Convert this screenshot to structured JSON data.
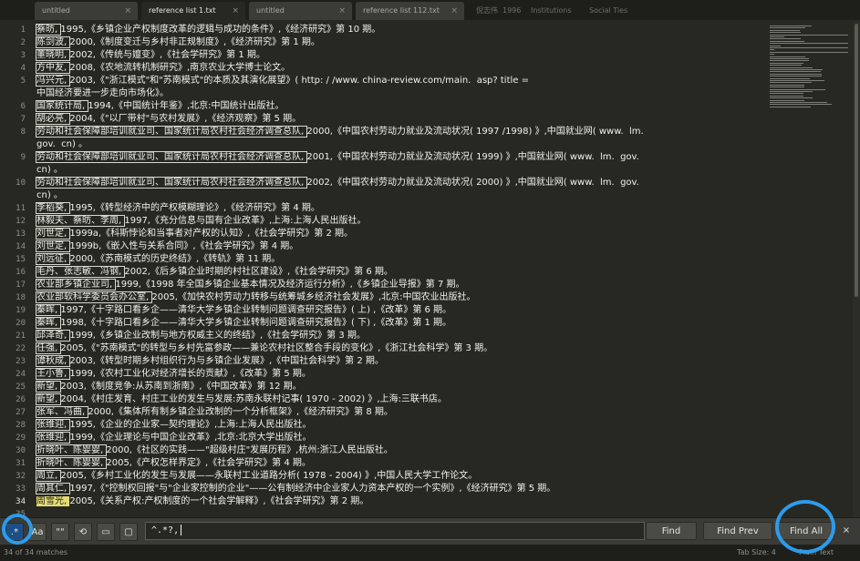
{
  "tabs": [
    {
      "label": "untitled",
      "active": false
    },
    {
      "label": "reference list 1.txt",
      "active": true
    },
    {
      "label": "untitled",
      "active": false
    },
    {
      "label": "reference list 112.txt",
      "active": false
    }
  ],
  "tab_close_glyph": "×",
  "ghost_text": [
    "倪志伟",
    "1996",
    "Institutions",
    "Social Ties"
  ],
  "lines": [
    {
      "n": "1",
      "segs": [
        {
          "t": "蔡昉, ",
          "h": 1
        },
        {
          "t": "1995,《乡镇企业产权制度改革的逻辑与成功的条件》,《经济研究》第 10 期。"
        }
      ]
    },
    {
      "n": "2",
      "segs": [
        {
          "t": "陈剑波, ",
          "h": 1
        },
        {
          "t": "2000,《制度变迁与乡村非正规制度》,《经济研究》第 1 期。"
        }
      ]
    },
    {
      "n": "3",
      "segs": [
        {
          "t": "董晓明, ",
          "h": 1
        },
        {
          "t": "2002,《传统与嬗变》,《社会学研究》第 1 期。"
        }
      ]
    },
    {
      "n": "4",
      "segs": [
        {
          "t": "方中友, ",
          "h": 1
        },
        {
          "t": "2008,《农地流转机制研究》,南京农业大学博士论文。"
        }
      ]
    },
    {
      "n": "5",
      "segs": [
        {
          "t": "冯兴元, ",
          "h": 1
        },
        {
          "t": "2003,《\"浙江模式\"和\"苏南模式\"的本质及其演化展望》( http: / /www. china-review.com/main.  asp? title ="
        }
      ]
    },
    {
      "n": "",
      "segs": [
        {
          "t": "中国经济要进一步走向市场化》。"
        }
      ]
    },
    {
      "n": "6",
      "segs": [
        {
          "t": "国家统计局, ",
          "h": 1
        },
        {
          "t": "1994,《中国统计年鉴》,北京:中国统计出版社。"
        }
      ]
    },
    {
      "n": "7",
      "segs": [
        {
          "t": "胡必亮, ",
          "h": 1
        },
        {
          "t": "2004,《\"以厂带村\"与农村发展》,《经济观察》第 5 期。"
        }
      ]
    },
    {
      "n": "8",
      "segs": [
        {
          "t": "劳动和社会保障部培训就业司、国家统计局农村社会经济调查总队, ",
          "h": 1
        },
        {
          "t": "2000,《中国农村劳动力就业及流动状况( 1997 /1998) 》,中国就业网( www.  lm."
        }
      ]
    },
    {
      "n": "",
      "segs": [
        {
          "t": "gov.  cn) 。"
        }
      ]
    },
    {
      "n": "9",
      "segs": [
        {
          "t": "劳动和社会保障部培训就业司、国家统计局农村社会经济调查总队, ",
          "h": 1
        },
        {
          "t": "2001,《中国农村劳动力就业及流动状况( 1999) 》,中国就业网( www.  lm.  gov."
        }
      ]
    },
    {
      "n": "",
      "segs": [
        {
          "t": "cn) 。"
        }
      ]
    },
    {
      "n": "10",
      "segs": [
        {
          "t": "劳动和社会保障部培训就业司、国家统计局农村社会经济调查总队, ",
          "h": 1
        },
        {
          "t": "2002,《中国农村劳动力就业及流动状况( 2000) 》,中国就业网( www.  lm.  gov."
        }
      ]
    },
    {
      "n": "",
      "segs": [
        {
          "t": "cn) 。"
        }
      ]
    },
    {
      "n": "11",
      "segs": [
        {
          "t": "李稻葵, ",
          "h": 1
        },
        {
          "t": "1995,《转型经济中的产权模糊理论》,《经济研究》第 4 期。"
        }
      ]
    },
    {
      "n": "12",
      "segs": [
        {
          "t": "林毅夫、蔡昉、李周, ",
          "h": 1
        },
        {
          "t": "1997,《充分信息与国有企业改革》,上海:上海人民出版社。"
        }
      ]
    },
    {
      "n": "13",
      "segs": [
        {
          "t": "刘世定, ",
          "h": 1
        },
        {
          "t": "1999a,《科斯悖论和当事者对产权的认知》,《社会学研究》第 2 期。"
        }
      ]
    },
    {
      "n": "14",
      "segs": [
        {
          "t": "刘世定, ",
          "h": 1
        },
        {
          "t": "1999b,《嵌入性与关系合同》,《社会学研究》第 4 期。"
        }
      ]
    },
    {
      "n": "15",
      "segs": [
        {
          "t": "刘远征, ",
          "h": 1
        },
        {
          "t": "2000,《苏南模式的历史终结》,《转轨》第 11 期。"
        }
      ]
    },
    {
      "n": "16",
      "segs": [
        {
          "t": "毛丹、张志敏、冯钢, ",
          "h": 1
        },
        {
          "t": "2002,《后乡镇企业时期的村社区建设》,《社会学研究》第 6 期。"
        }
      ]
    },
    {
      "n": "17",
      "segs": [
        {
          "t": "农业部乡镇企业司, ",
          "h": 1
        },
        {
          "t": "1999,《1998 年全国乡镇企业基本情况及经济运行分析》,《乡镇企业导报》第 7 期。"
        }
      ]
    },
    {
      "n": "18",
      "segs": [
        {
          "t": "农业部软科学委员会办公室, ",
          "h": 1
        },
        {
          "t": "2005,《加快农村劳动力转移与统筹城乡经济社会发展》,北京:中国农业出版社。"
        }
      ]
    },
    {
      "n": "19",
      "segs": [
        {
          "t": "秦晖, ",
          "h": 1
        },
        {
          "t": "1997,《十字路口看乡企——清华大学乡镇企业转制问题调查研究报告》( 上) ,《改革》第 6 期。"
        }
      ]
    },
    {
      "n": "20",
      "segs": [
        {
          "t": "秦晖, ",
          "h": 1
        },
        {
          "t": "1998,《十字路口看乡企——清华大学乡镇企业转制问题调查研究报告》( 下) ,《改革》第 1 期。"
        }
      ]
    },
    {
      "n": "21",
      "segs": [
        {
          "t": "邱泽奇, ",
          "h": 1
        },
        {
          "t": "1999,《乡镇企业改制与地方权威主义的终结》,《社会学研究》第 3 期。"
        }
      ]
    },
    {
      "n": "22",
      "segs": [
        {
          "t": "任强, ",
          "h": 1
        },
        {
          "t": "2005,《\"苏南模式\"的转型与乡村先富参政——兼论农村社区整合手段的变化》,《浙江社会科学》第 3 期。"
        }
      ]
    },
    {
      "n": "23",
      "segs": [
        {
          "t": "谭秋成, ",
          "h": 1
        },
        {
          "t": "2003,《转型时期乡村组织行为与乡镇企业发展》,《中国社会科学》第 2 期。"
        }
      ]
    },
    {
      "n": "24",
      "segs": [
        {
          "t": "王小鲁, ",
          "h": 1
        },
        {
          "t": "1999,《农村工业化对经济增长的贡献》,《改革》第 5 期。"
        }
      ]
    },
    {
      "n": "25",
      "segs": [
        {
          "t": "新望, ",
          "h": 1
        },
        {
          "t": "2003,《制度竞争:从苏南到浙南》,《中国改革》第 12 期。"
        }
      ]
    },
    {
      "n": "26",
      "segs": [
        {
          "t": "新望, ",
          "h": 1
        },
        {
          "t": "2004,《村庄发育、村庄工业的发生与发展:苏南永联村记事( 1970 - 2002) 》,上海:三联书店。"
        }
      ]
    },
    {
      "n": "27",
      "segs": [
        {
          "t": "张军、冯曲, ",
          "h": 1
        },
        {
          "t": "2000,《集体所有制乡镇企业改制的一个分析框架》,《经济研究》第 8 期。"
        }
      ]
    },
    {
      "n": "28",
      "segs": [
        {
          "t": "张维迎, ",
          "h": 1
        },
        {
          "t": "1995,《企业的企业家—契约理论》,上海:上海人民出版社。"
        }
      ]
    },
    {
      "n": "29",
      "segs": [
        {
          "t": "张维迎, ",
          "h": 1
        },
        {
          "t": "1999,《企业理论与中国企业改革》,北京:北京大学出版社。"
        }
      ]
    },
    {
      "n": "30",
      "segs": [
        {
          "t": "折晓叶、陈婴婴, ",
          "h": 1
        },
        {
          "t": "2000,《社区的实践——\"超级村庄\"发展历程》,杭州:浙江人民出版社。"
        }
      ]
    },
    {
      "n": "31",
      "segs": [
        {
          "t": "折晓叶、陈婴婴, ",
          "h": 1
        },
        {
          "t": "2005,《产权怎样界定》,《社会学研究》第 4 期。"
        }
      ]
    },
    {
      "n": "32",
      "segs": [
        {
          "t": "周立, ",
          "h": 1
        },
        {
          "t": "2005,《乡村工业化的发生与发展——永联村工业道路分析( 1978 - 2004) 》,中国人民大学工作论文。"
        }
      ]
    },
    {
      "n": "33",
      "segs": [
        {
          "t": "周其仁, ",
          "h": 1
        },
        {
          "t": "1997,《\"控制权回报\"与\"企业家控制的企业\"——公有制经济中企业家人力资本产权的一个实例》,《经济研究》第 5 期。"
        }
      ]
    },
    {
      "n": "34",
      "cur": 1,
      "segs": [
        {
          "t": "周雪光, ",
          "h": 2
        },
        {
          "t": "2005,《关系产权:产权制度的一个社会学解释》,《社会学研究》第 2 期。"
        }
      ]
    },
    {
      "n": "35",
      "segs": []
    }
  ],
  "find": {
    "opt_regex": ".*",
    "opt_case": "Aa",
    "opt_word": "\"\"",
    "opt_wrap": "⟲",
    "opt_selection": "▭",
    "opt_highlight": "▢",
    "query": "^.*?,",
    "find_label": "Find",
    "find_prev_label": "Find Prev",
    "find_all_label": "Find All",
    "close_glyph": "×",
    "regex_enabled": true
  },
  "status": {
    "matches": "34 of 34 matches",
    "tab_size": "Tab Size: 4",
    "syntax": "Plain Text"
  },
  "colors": {
    "background": "#272822",
    "selection": "#e6db74",
    "annotation": "#2e9bea",
    "toggle_on": "#1d4f86"
  }
}
